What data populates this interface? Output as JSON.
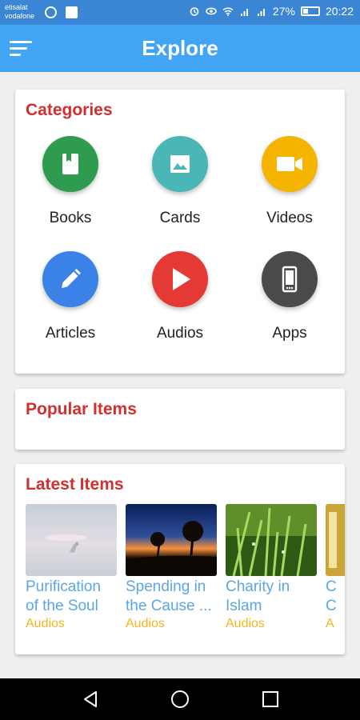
{
  "status_bar": {
    "carrier_1": "etisalat",
    "carrier_2": "vodafone",
    "battery": "27%",
    "time": "20:22",
    "signal_1": "3G",
    "signal_2": "4G"
  },
  "app_bar": {
    "title": "Explore",
    "color": "#42a4f4"
  },
  "categories": {
    "title": "Categories",
    "items": [
      {
        "label": "Books",
        "color": "#2e9b4f",
        "icon": "book-icon"
      },
      {
        "label": "Cards",
        "color": "#4bb6b6",
        "icon": "image-icon"
      },
      {
        "label": "Videos",
        "color": "#f5b400",
        "icon": "video-camera-icon"
      },
      {
        "label": "Articles",
        "color": "#3b82e8",
        "icon": "pencil-icon"
      },
      {
        "label": "Audios",
        "color": "#e53935",
        "icon": "play-icon"
      },
      {
        "label": "Apps",
        "color": "#4a4a4a",
        "icon": "smartphone-icon"
      }
    ]
  },
  "popular": {
    "title": "Popular Items"
  },
  "latest": {
    "title": "Latest Items",
    "items": [
      {
        "title_line_1": "Purification",
        "title_line_2": "of the Soul",
        "category": "Audios"
      },
      {
        "title_line_1": "Spending in",
        "title_line_2": "the Cause ...",
        "category": "Audios"
      },
      {
        "title_line_1": "Charity in",
        "title_line_2": "Islam",
        "category": "Audios"
      },
      {
        "title_line_1": "C",
        "title_line_2": "C",
        "category": "A"
      }
    ]
  }
}
